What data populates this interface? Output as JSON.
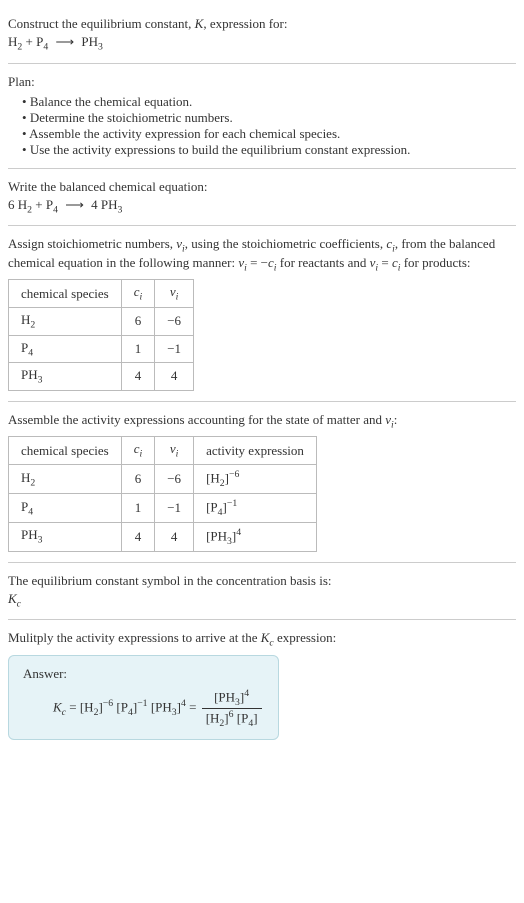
{
  "intro": {
    "line1_prefix": "Construct the equilibrium constant, ",
    "line1_K": "K",
    "line1_suffix": ", expression for:",
    "eq_lhs_h2": "H",
    "eq_lhs_h2_sub": "2",
    "eq_plus": " + ",
    "eq_lhs_p4": "P",
    "eq_lhs_p4_sub": "4",
    "eq_arrow": "⟶",
    "eq_rhs_ph3": "PH",
    "eq_rhs_ph3_sub": "3"
  },
  "plan": {
    "heading": "Plan:",
    "items": [
      "Balance the chemical equation.",
      "Determine the stoichiometric numbers.",
      "Assemble the activity expression for each chemical species.",
      "Use the activity expressions to build the equilibrium constant expression."
    ]
  },
  "balanced": {
    "heading": "Write the balanced chemical equation:",
    "c1": "6 H",
    "c1_sub": "2",
    "plus": " + ",
    "c2": "P",
    "c2_sub": "4",
    "arrow": "⟶",
    "c3": "4 PH",
    "c3_sub": "3"
  },
  "stoich": {
    "desc_1": "Assign stoichiometric numbers, ",
    "desc_nu": "ν",
    "desc_nu_sub": "i",
    "desc_2": ", using the stoichiometric coefficients, ",
    "desc_c": "c",
    "desc_c_sub": "i",
    "desc_3": ", from the balanced chemical equation in the following manner: ",
    "desc_eq1_lhs": "ν",
    "desc_eq1_lhs_sub": "i",
    "desc_eq1_mid": " = −",
    "desc_eq1_rhs": "c",
    "desc_eq1_rhs_sub": "i",
    "desc_4": " for reactants and ",
    "desc_eq2_lhs": "ν",
    "desc_eq2_lhs_sub": "i",
    "desc_eq2_mid": " = ",
    "desc_eq2_rhs": "c",
    "desc_eq2_rhs_sub": "i",
    "desc_5": " for products:",
    "headers": {
      "species": "chemical species",
      "ci": "c",
      "ci_sub": "i",
      "nui": "ν",
      "nui_sub": "i"
    },
    "rows": [
      {
        "sp": "H",
        "sp_sub": "2",
        "c": "6",
        "nu": "−6"
      },
      {
        "sp": "P",
        "sp_sub": "4",
        "c": "1",
        "nu": "−1"
      },
      {
        "sp": "PH",
        "sp_sub": "3",
        "c": "4",
        "nu": "4"
      }
    ]
  },
  "activity": {
    "desc_1": "Assemble the activity expressions accounting for the state of matter and ",
    "desc_nu": "ν",
    "desc_nu_sub": "i",
    "desc_2": ":",
    "headers": {
      "species": "chemical species",
      "ci": "c",
      "ci_sub": "i",
      "nui": "ν",
      "nui_sub": "i",
      "act": "activity expression"
    },
    "rows": [
      {
        "sp": "H",
        "sp_sub": "2",
        "c": "6",
        "nu": "−6",
        "act_base": "[H",
        "act_sub": "2",
        "act_close": "]",
        "act_exp": "−6"
      },
      {
        "sp": "P",
        "sp_sub": "4",
        "c": "1",
        "nu": "−1",
        "act_base": "[P",
        "act_sub": "4",
        "act_close": "]",
        "act_exp": "−1"
      },
      {
        "sp": "PH",
        "sp_sub": "3",
        "c": "4",
        "nu": "4",
        "act_base": "[PH",
        "act_sub": "3",
        "act_close": "]",
        "act_exp": "4"
      }
    ]
  },
  "symbol": {
    "line": "The equilibrium constant symbol in the concentration basis is:",
    "kc": "K",
    "kc_sub": "c"
  },
  "final": {
    "line_1": "Mulitply the activity expressions to arrive at the ",
    "kc": "K",
    "kc_sub": "c",
    "line_2": " expression:",
    "answer_label": "Answer:",
    "lhs_k": "K",
    "lhs_k_sub": "c",
    "eq": " = ",
    "t1": "[H",
    "t1_sub": "2",
    "t1_close": "]",
    "t1_exp": "−6",
    "t2": "[P",
    "t2_sub": "4",
    "t2_close": "]",
    "t2_exp": "−1",
    "t3": "[PH",
    "t3_sub": "3",
    "t3_close": "]",
    "t3_exp": "4",
    "eq2": " = ",
    "num": "[PH",
    "num_sub": "3",
    "num_close": "]",
    "num_exp": "4",
    "den1": "[H",
    "den1_sub": "2",
    "den1_close": "]",
    "den1_exp": "6",
    "den2": "[P",
    "den2_sub": "4",
    "den2_close": "]"
  }
}
